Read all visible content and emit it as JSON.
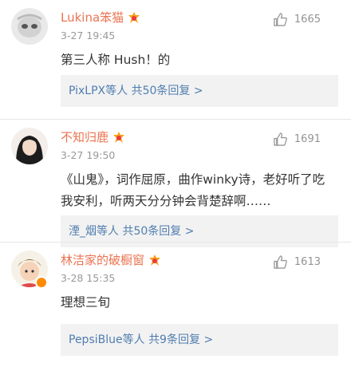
{
  "colors": {
    "username": "#eb7350",
    "link": "#507daf",
    "muted": "#999999",
    "reply_bg": "#f2f2f2"
  },
  "comments": [
    {
      "username": "Lukina笨猫",
      "time": "3-27 19:45",
      "likes": "1665",
      "text": "第三人称 Hush！的",
      "reply_users": "PixLPX等人",
      "reply_count": "共50条回复",
      "reply_chevron": ">"
    },
    {
      "username": "不知归鹿",
      "time": "3-27 19:50",
      "likes": "1691",
      "text": "《山鬼》，词作屈原，曲作winky诗，老好听了吃我安利，听两天分分钟会背楚辞啊……",
      "reply_users": "湮_烟等人",
      "reply_count": "共50条回复",
      "reply_chevron": ">"
    },
    {
      "username": "林洁家的破橱窗",
      "time": "3-28 15:35",
      "likes": "1613",
      "text": "理想三旬",
      "reply_users": "PepsiBlue等人",
      "reply_count": "共9条回复",
      "reply_chevron": ">"
    }
  ]
}
